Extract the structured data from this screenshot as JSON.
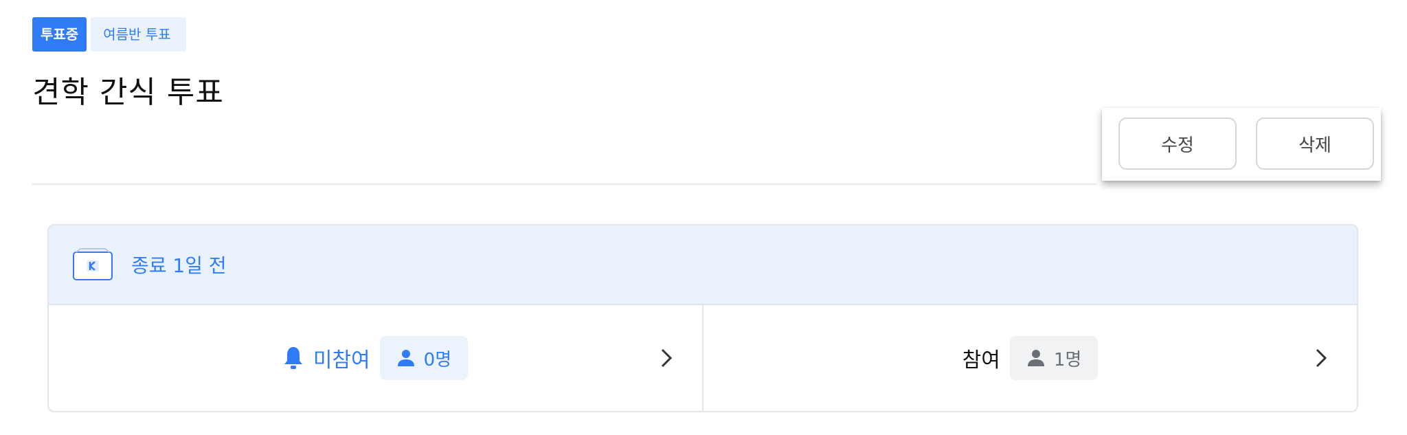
{
  "badges": {
    "status": "투표중",
    "class_name": "여름반 투표"
  },
  "title": "견학 간식 투표",
  "actions": {
    "edit_label": "수정",
    "delete_label": "삭제"
  },
  "card": {
    "deadline": "종료 1일 전",
    "not_participated": {
      "label": "미참여",
      "count": "0명"
    },
    "participated": {
      "label": "참여",
      "count": "1명"
    }
  },
  "colors": {
    "accent": "#2f7cf6",
    "header_bg": "#e9f1fc"
  },
  "icons": [
    "deadline-box-icon",
    "bell-icon",
    "person-icon",
    "chevron-right-icon"
  ]
}
